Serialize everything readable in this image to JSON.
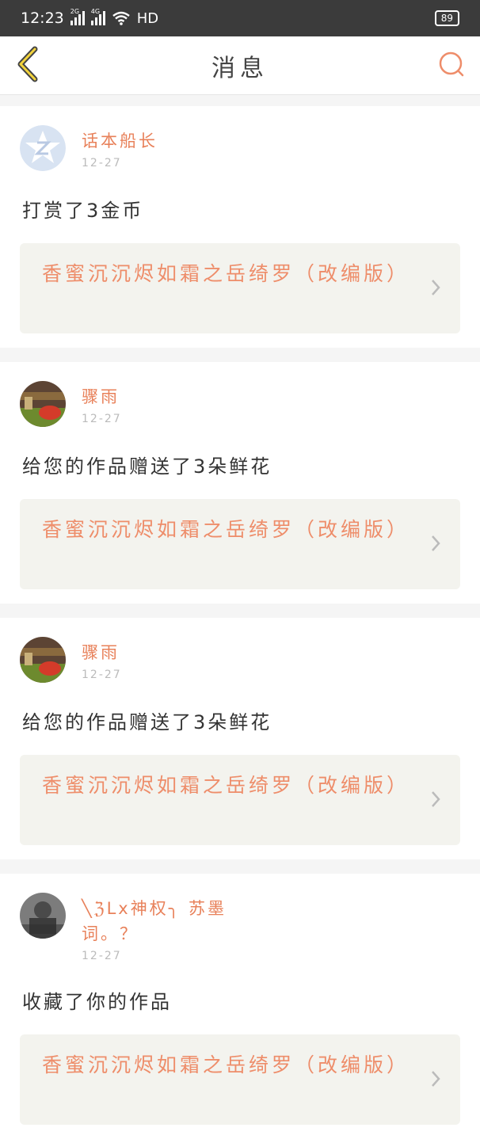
{
  "status_bar": {
    "time": "12:23",
    "signal1_tag": "2G",
    "signal2_tag": "4G",
    "network": "HD",
    "battery": "89"
  },
  "nav": {
    "title": "消息",
    "back_icon": "chevron-left-icon",
    "search_icon": "search-icon"
  },
  "messages": [
    {
      "user": "话本船长",
      "date": "12-27",
      "action": "打赏了3金币",
      "work_title": "香蜜沉沉烬如霜之岳绮罗（改编版）"
    },
    {
      "user": "骤雨",
      "date": "12-27",
      "action": "给您的作品赠送了3朵鲜花",
      "work_title": "香蜜沉沉烬如霜之岳绮罗（改编版）"
    },
    {
      "user": "骤雨",
      "date": "12-27",
      "action": "给您的作品赠送了3朵鲜花",
      "work_title": "香蜜沉沉烬如霜之岳绮罗（改编版）"
    },
    {
      "user": "╲ℨLx神权╮ 苏墨词。？",
      "date": "12-27",
      "action": "收藏了你的作品",
      "work_title": "香蜜沉沉烬如霜之岳绮罗（改编版）"
    }
  ],
  "colors": {
    "accent": "#e8815a",
    "work_bg": "#f3f3ee",
    "status_bg": "#3b3b3b"
  }
}
